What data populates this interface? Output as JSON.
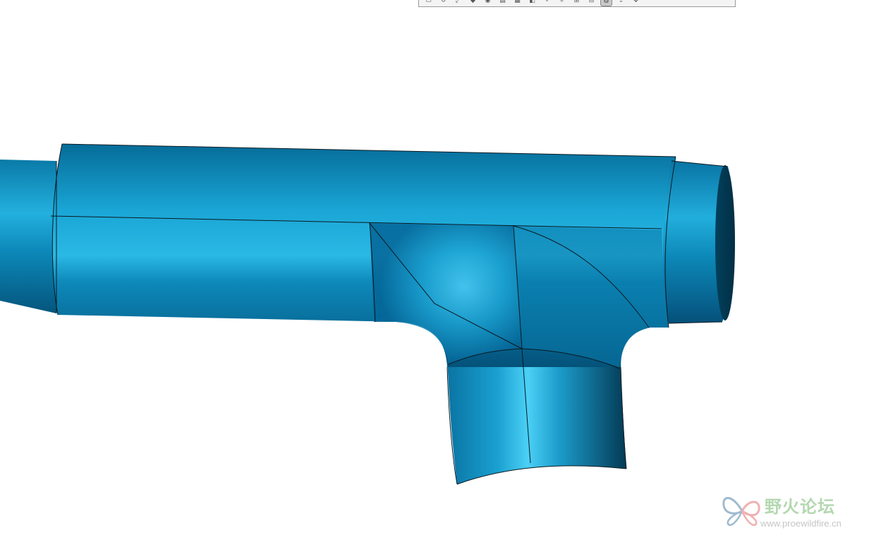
{
  "toolbar": {
    "buttons": [
      {
        "name": "zoom-area-icon",
        "glyph": "▭"
      },
      {
        "name": "repaint-icon",
        "glyph": "↻"
      },
      {
        "name": "refit-icon",
        "glyph": "⤢"
      },
      {
        "name": "display-style-icon",
        "glyph": "◆"
      },
      {
        "name": "view-orient-icon",
        "glyph": "◉"
      },
      {
        "name": "saved-views-icon",
        "glyph": "▤"
      },
      {
        "name": "view-manager-icon",
        "glyph": "▦"
      },
      {
        "name": "datum-display-icon",
        "glyph": "◧"
      },
      {
        "name": "annotation-display-icon",
        "glyph": "⌖"
      },
      {
        "name": "spin-center-icon",
        "glyph": "✳"
      },
      {
        "name": "plane-display-icon",
        "glyph": "⊞"
      },
      {
        "name": "axis-display-icon",
        "glyph": "⊟"
      },
      {
        "name": "point-display-icon",
        "glyph": "◍",
        "active": true
      },
      {
        "name": "csys-display-icon",
        "glyph": "⌄"
      },
      {
        "name": "pan-icon",
        "glyph": "✥"
      }
    ]
  },
  "model": {
    "name": "pipe-tee-surface",
    "colors": {
      "body": "#0b84b4",
      "highlight": "#3cc4ef",
      "shadow": "#05405a",
      "edge": "#0a1a22"
    }
  },
  "watermark": {
    "title": "野火论坛",
    "url": "www.proewildfire.cn",
    "colors": {
      "title": "#b4d8b0",
      "url": "#c6c6c6",
      "logo_a": "#9fbad0",
      "logo_b": "#f0b0b0"
    }
  }
}
